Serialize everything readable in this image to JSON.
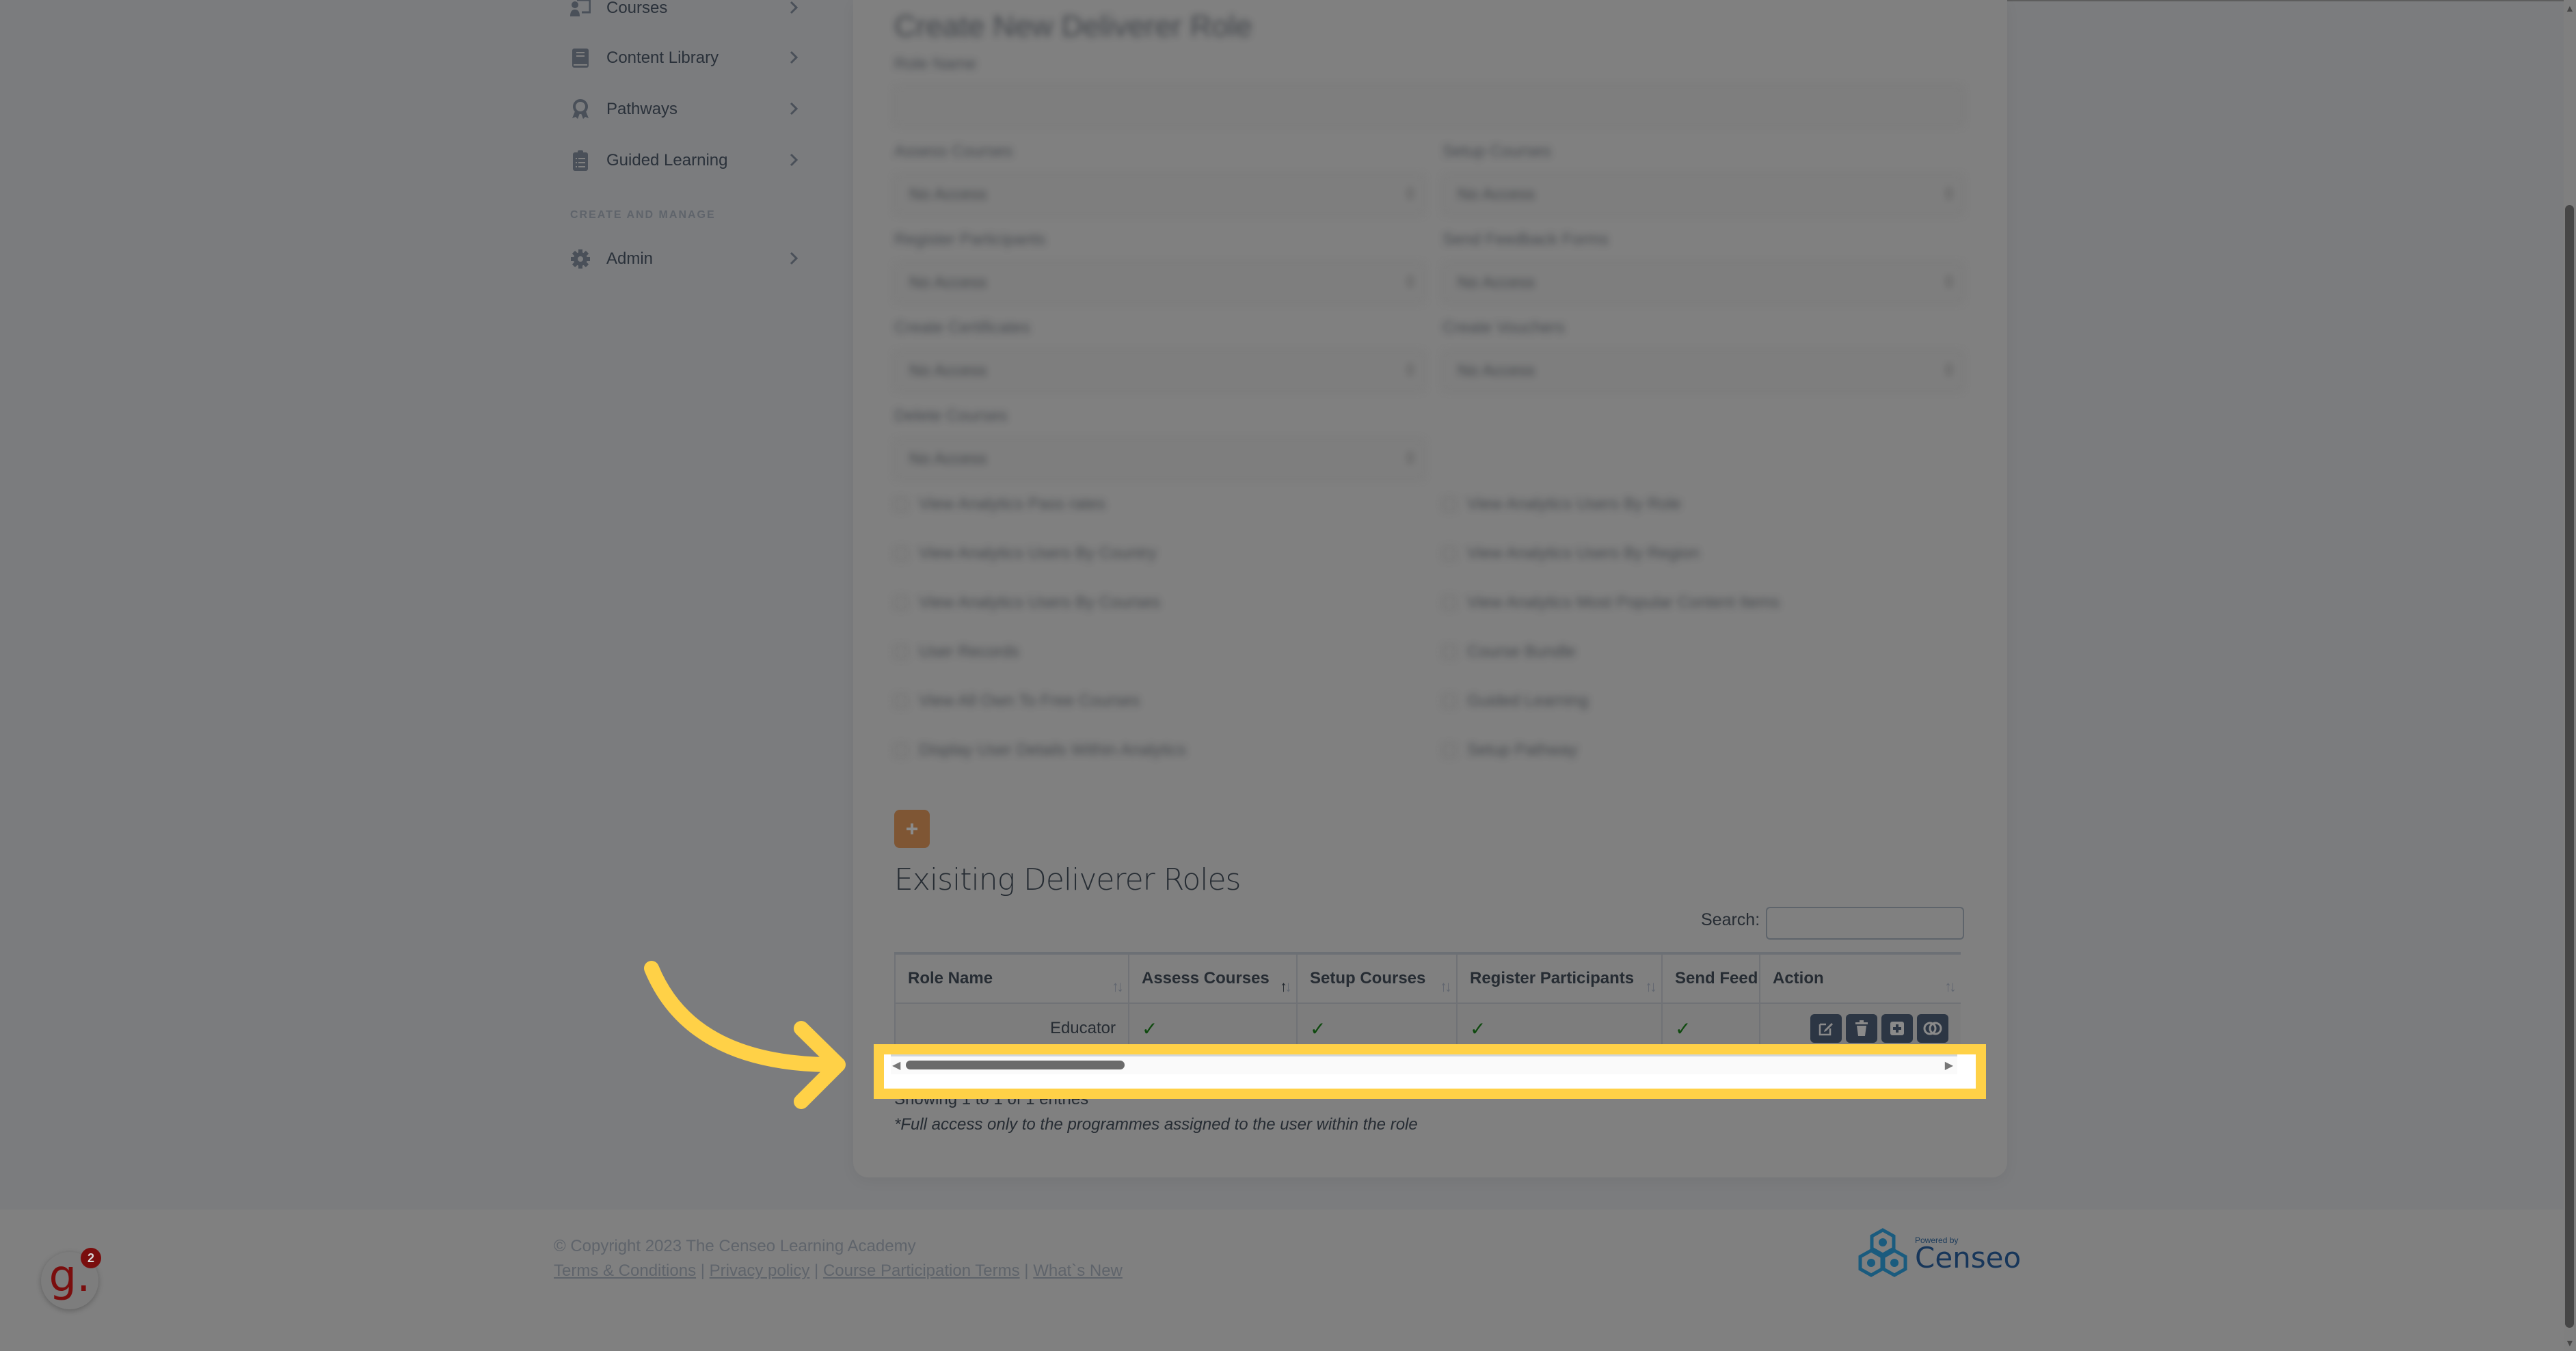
{
  "sidebar": {
    "items": [
      {
        "label": "Courses",
        "icon": "chalkboard-user-icon"
      },
      {
        "label": "Content Library",
        "icon": "book-icon"
      },
      {
        "label": "Pathways",
        "icon": "award-icon"
      },
      {
        "label": "Guided Learning",
        "icon": "clipboard-list-icon"
      }
    ],
    "section_label": "CREATE AND MANAGE",
    "admin": {
      "label": "Admin",
      "icon": "gear-icon"
    }
  },
  "form": {
    "title": "Create New Deliverer Role",
    "role_name_label": "Role Name",
    "role_name_value": "",
    "selects": [
      {
        "label": "Assess Courses",
        "value": "No Access"
      },
      {
        "label": "Setup Courses",
        "value": "No Access"
      },
      {
        "label": "Register Participants",
        "value": "No Access"
      },
      {
        "label": "Send Feedback Forms",
        "value": "No Access"
      },
      {
        "label": "Create Certificates",
        "value": "No Access"
      },
      {
        "label": "Create Vouchers",
        "value": "No Access"
      },
      {
        "label": "Delete Courses",
        "value": "No Access"
      }
    ],
    "checkboxes": [
      {
        "label": "View Analytics Pass rates",
        "checked": false
      },
      {
        "label": "View Analytics Users By Role",
        "checked": false
      },
      {
        "label": "View Analytics Users By Country",
        "checked": false
      },
      {
        "label": "View Analytics Users By Region",
        "checked": false
      },
      {
        "label": "View Analytics Users By Courses",
        "checked": false
      },
      {
        "label": "View Analytics Most Popular Content Items",
        "checked": false
      },
      {
        "label": "User Records",
        "checked": false
      },
      {
        "label": "Course Bundle",
        "checked": false
      },
      {
        "label": "View All Own To Free Courses",
        "checked": false
      },
      {
        "label": "Guided Learning",
        "checked": false
      },
      {
        "label": "Display User Details Within Analytics",
        "checked": false
      },
      {
        "label": "Setup Pathway",
        "checked": false
      }
    ],
    "add_button_label": "+"
  },
  "existing": {
    "title": "Exisiting Deliverer Roles",
    "search_label": "Search:",
    "search_value": "",
    "columns": [
      {
        "label": "Role Name",
        "sort": "none"
      },
      {
        "label": "Assess Courses",
        "sort": "asc"
      },
      {
        "label": "Setup Courses",
        "sort": "none"
      },
      {
        "label": "Register Participants",
        "sort": "none"
      },
      {
        "label": "Send Feedl",
        "sort": "none"
      },
      {
        "label": "Action",
        "sort": "none"
      }
    ],
    "rows": [
      {
        "role": "Educator",
        "assess": "✓",
        "setup": "✓",
        "register": "✓",
        "feedback": "✓",
        "actions": [
          "edit-icon",
          "trash-icon",
          "plus-square-icon",
          "toggle-icon"
        ]
      }
    ],
    "showing": "Showing 1 to 1 of 1 entries",
    "note": "*Full access only to the programmes assigned to the user within the role"
  },
  "footer": {
    "copyright": "© Copyright 2023 The Censeo Learning Academy",
    "links": [
      "Terms & Conditions",
      "Privacy policy",
      "Course Participation Terms",
      "What`s New"
    ],
    "separator": " | ",
    "powered_by": "Powered by",
    "brand": "Censeo"
  },
  "widget": {
    "letter": "g.",
    "count": "2"
  },
  "colors": {
    "highlight": "#ffd147",
    "add_button": "#7f5634",
    "action_button": "#2c3644",
    "check": "#0f4a0f",
    "brand": "#17365a",
    "widget": "#7a0e0e"
  }
}
